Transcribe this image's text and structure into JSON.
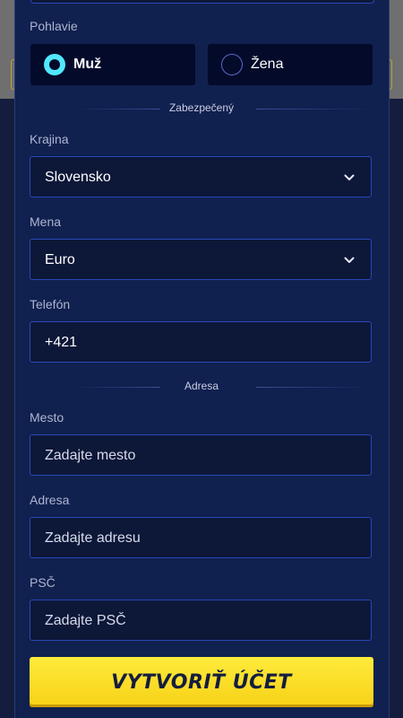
{
  "form": {
    "gender": {
      "label": "Pohlavie",
      "options": [
        {
          "label": "Muž",
          "selected": true
        },
        {
          "label": "Žena",
          "selected": false
        }
      ]
    },
    "section_secure": "Zabezpečený",
    "country": {
      "label": "Krajina",
      "value": "Slovensko"
    },
    "currency": {
      "label": "Mena",
      "value": "Euro"
    },
    "phone": {
      "label": "Telefón",
      "value": "+421"
    },
    "section_address": "Adresa",
    "city": {
      "label": "Mesto",
      "placeholder": "Zadajte mesto"
    },
    "address": {
      "label": "Adresa",
      "placeholder": "Zadajte adresu"
    },
    "zip": {
      "label": "PSČ",
      "placeholder": "Zadajte PSČ"
    },
    "submit_label": "VYTVORIŤ ÚČET"
  },
  "colors": {
    "accent_radio": "#52e7ff",
    "button": "#ffeb3b",
    "panel": "#10204f",
    "field_border": "#2a48b8"
  },
  "icons": {
    "radio_checked": "radio-checked-icon",
    "radio_unchecked": "radio-unchecked-icon",
    "dropdown": "chevron-down-icon"
  }
}
